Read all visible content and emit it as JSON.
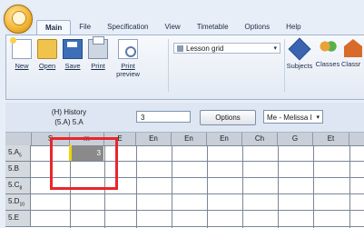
{
  "tabs": [
    {
      "label": "Main"
    },
    {
      "label": "File"
    },
    {
      "label": "Specification"
    },
    {
      "label": "View"
    },
    {
      "label": "Timetable"
    },
    {
      "label": "Options"
    },
    {
      "label": "Help"
    }
  ],
  "ribbon": {
    "new": "New",
    "open": "Open",
    "save": "Save",
    "print": "Print",
    "print_preview_line1": "Print",
    "print_preview_line2": "preview",
    "view_combo": "Lesson grid",
    "subjects": "Subjects",
    "classes": "Classes",
    "classrooms": "Classr"
  },
  "info": {
    "title_line1": "(H) History",
    "title_line2": "(5.A) 5.A",
    "lesson_value": "3",
    "options_button": "Options",
    "teacher_select": "Me - Melissa I"
  },
  "grid": {
    "columns": [
      "S",
      "m",
      "E",
      "En",
      "En",
      "En",
      "Ch",
      "G",
      "Et"
    ],
    "rows": [
      "5.A",
      "5.B",
      "5.C",
      "5.D",
      "5.E"
    ],
    "row_subscripts": [
      "5",
      "",
      "8",
      "10",
      ""
    ],
    "filled_cell_value": "3"
  },
  "colors": {
    "highlight": "#e8262a",
    "filled_cell": "#8a8a8a",
    "filled_marker": "#f0d400"
  }
}
